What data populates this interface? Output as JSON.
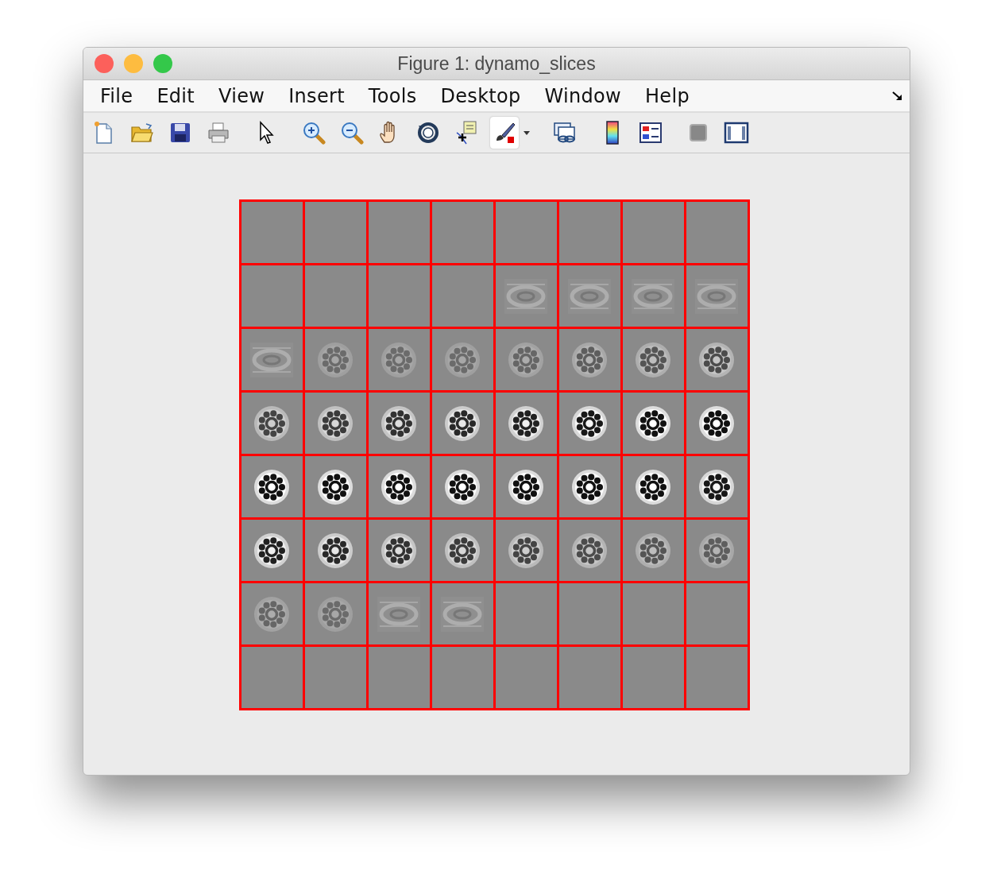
{
  "window": {
    "title": "Figure 1: dynamo_slices"
  },
  "menu": [
    "File",
    "Edit",
    "View",
    "Insert",
    "Tools",
    "Desktop",
    "Window",
    "Help"
  ],
  "toolbar": [
    [
      {
        "kind": "new",
        "selected": false
      },
      {
        "kind": "open",
        "selected": false
      },
      {
        "kind": "save",
        "selected": false
      },
      {
        "kind": "print",
        "selected": false
      }
    ],
    [
      {
        "kind": "pointer",
        "selected": false
      }
    ],
    [
      {
        "kind": "zoom-in",
        "selected": false
      },
      {
        "kind": "zoom-out",
        "selected": false
      },
      {
        "kind": "pan",
        "selected": false
      },
      {
        "kind": "rotate",
        "selected": false
      },
      {
        "kind": "data-cursor",
        "selected": false
      },
      {
        "kind": "brush",
        "selected": true
      },
      {
        "kind": "dropdown",
        "selected": false
      }
    ],
    [
      {
        "kind": "link",
        "selected": false
      }
    ],
    [
      {
        "kind": "colorbar",
        "selected": false
      },
      {
        "kind": "legend",
        "selected": false
      }
    ],
    [
      {
        "kind": "hide-tools",
        "selected": false
      },
      {
        "kind": "show-tools",
        "selected": false
      }
    ]
  ]
}
